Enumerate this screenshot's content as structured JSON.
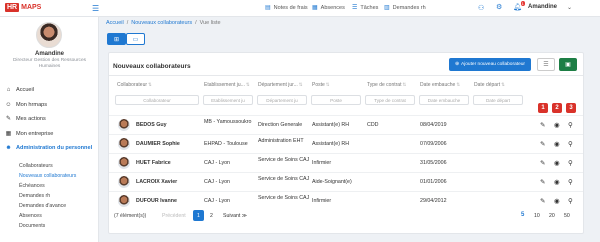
{
  "brand": {
    "hr": "HR",
    "maps": "MAPS"
  },
  "topnav": [
    {
      "icon": "receipt-icon",
      "glyph": "▤",
      "label": "Notes de frais"
    },
    {
      "icon": "absence-icon",
      "glyph": "▦",
      "label": "Absences"
    },
    {
      "icon": "tasks-icon",
      "glyph": "☰",
      "label": "Tâches"
    },
    {
      "icon": "request-icon",
      "glyph": "▥",
      "label": "Demandes rh"
    }
  ],
  "user": {
    "name": "Amandine",
    "role": "Directeur Gestion des Ressources Humaines",
    "notifications": "1"
  },
  "sidebar": {
    "items": [
      {
        "label": "Accueil",
        "glyph": "⌂",
        "icon": "home-icon"
      },
      {
        "label": "Mon hrmaps",
        "glyph": "☺",
        "icon": "user-icon"
      },
      {
        "label": "Mes actions",
        "glyph": "✎",
        "icon": "actions-icon"
      },
      {
        "label": "Mon entreprise",
        "glyph": "▦",
        "icon": "building-icon"
      },
      {
        "label": "Administration du personnel",
        "glyph": "☻",
        "icon": "admin-icon"
      }
    ],
    "sub": [
      "Collaborateurs",
      "Nouveaux collaborateurs",
      "Échéances",
      "Demandes rh",
      "Demandes d'avance",
      "Absences",
      "Documents"
    ]
  },
  "breadcrumb": {
    "home": "Accueil",
    "section": "Nouveaux collaborateurs",
    "current": "Vue liste"
  },
  "card": {
    "title": "Nouveaux collaborateurs",
    "add_label": "Ajouter nouveau collaborateur",
    "columns": [
      "Collaborateur",
      "Etablissement ju...",
      "Département jur...",
      "Poste",
      "Type de contrat",
      "Date embauche",
      "Date départ"
    ],
    "filters": [
      "Collaborateur",
      "Etablissement ju",
      "Département ju",
      "Poste",
      "Type de contrat",
      "Date embauche",
      "Date départ"
    ],
    "badges": [
      "1",
      "2",
      "3"
    ],
    "rows": [
      {
        "name": "BEDOS Guy",
        "etab": "MB - Yamoussoukro",
        "dept": "Direction Generale",
        "poste": "Assistant(e) RH",
        "contrat": "CDD",
        "embauche": "08/04/2019",
        "depart": ""
      },
      {
        "name": "DAUMIER Sophie",
        "etab": "EHPAD - Toulouse",
        "dept": "Administration EHT",
        "poste": "Assistant(e) RH",
        "contrat": "",
        "embauche": "07/09/2006",
        "depart": ""
      },
      {
        "name": "HUET Fabrice",
        "etab": "CAJ - Lyon",
        "dept": "Service de Soins CAJ",
        "poste": "Infirmier",
        "contrat": "",
        "embauche": "31/05/2006",
        "depart": ""
      },
      {
        "name": "LACROIX Xavier",
        "etab": "CAJ - Lyon",
        "dept": "Service de Soins CAJ",
        "poste": "Aide-Soignant(e)",
        "contrat": "",
        "embauche": "01/01/2006",
        "depart": ""
      },
      {
        "name": "DUFOUR Ivanne",
        "etab": "CAJ - Lyon",
        "dept": "Service de Soins CAJ",
        "poste": "Infirmier",
        "contrat": "",
        "embauche": "29/04/2012",
        "depart": ""
      }
    ],
    "pager": {
      "count": "(7 élément(s))",
      "prev": "Précédent",
      "pages": [
        "1",
        "2"
      ],
      "next": "Suivant",
      "sizes": [
        "5",
        "10",
        "20",
        "50"
      ]
    }
  },
  "colors": {
    "accent": "#1f78d1",
    "brand": "#d9322a",
    "excel": "#1d7e45"
  }
}
